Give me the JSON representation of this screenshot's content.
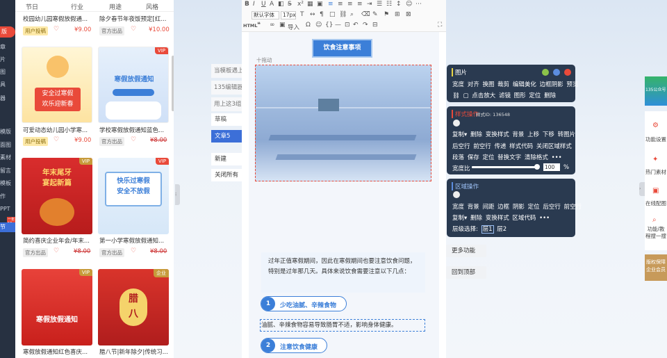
{
  "leftnav": {
    "items": [
      "版",
      "章",
      "片",
      "图",
      "具",
      "器",
      "模版",
      "面图",
      "素材",
      "留言",
      "模板",
      "作",
      "PPT",
      "节"
    ],
    "badge": "一年18"
  },
  "tplpanel": {
    "tabs": [
      "节日",
      "行业",
      "用途",
      "风格"
    ],
    "cards": [
      {
        "title": "校园幼儿园寒假放假通...",
        "tag": "用户投稿",
        "price": "¥9.00",
        "strike": false,
        "vip": false,
        "img_text": ""
      },
      {
        "title": "除夕春节年夜饭预定[红...",
        "tag": "官方出品",
        "price": "¥10.00",
        "strike": false,
        "vip": false,
        "img_text": ""
      },
      {
        "title": "可爱动态幼儿园小学寒...",
        "tag": "用户投稿",
        "price": "¥9.00",
        "strike": false,
        "vip": false,
        "img_text": "安全过寒假\n欢乐迎新春"
      },
      {
        "title": "学校寒假放假通知蓝色...",
        "tag": "官方出品",
        "price": "¥8.00",
        "strike": true,
        "vip": true,
        "img_text": "寒假放假通知"
      },
      {
        "title": "简约喜庆企业年会/年末...",
        "tag": "官方出品",
        "price": "¥8.00",
        "strike": true,
        "vip": true,
        "img_text": "年末尾牙\n宴起新篇"
      },
      {
        "title": "第一小学寒假放假通知...",
        "tag": "官方出品",
        "price": "¥8.00",
        "strike": true,
        "vip": true,
        "img_text": "快乐过寒假\n安全不放假"
      },
      {
        "title": "寒假放假通知红色喜庆...",
        "tag": "",
        "price": "",
        "strike": false,
        "vip": true,
        "img_text": "寒假放假通知"
      },
      {
        "title": "腊八节|新年除夕|传统习...",
        "tag": "",
        "price": "",
        "strike": false,
        "vip": false,
        "badge": "企业",
        "img_text": "腊\n八"
      }
    ]
  },
  "doclist": {
    "links": [
      "当模板遇上",
      "135编辑器",
      "用上这3组"
    ],
    "drafts": [
      "草稿",
      "文章5"
    ],
    "actions": [
      "新建",
      "关闭所有"
    ]
  },
  "toolbar": {
    "font_family": "默认字体",
    "font_size": "17px",
    "html_label": "HTML",
    "import_label": "导入"
  },
  "content": {
    "heading": "饮食注意事项",
    "drag_label": "十拖动",
    "intro": "过年正值寒假期间，因此在寒假期间也要注意饮食问题，特别是过年那几天。具体来说饮食需要注意以下几点：",
    "section1_num": "1",
    "section1_title": "少吃油腻、辛辣食物",
    "section1_text": "油腻、辛辣食物容易导致肠胃不适，影响身体健康。",
    "section2_num": "2",
    "section2_title": "注意饮食健康"
  },
  "panel_image": {
    "title": "图片",
    "row1": [
      "宽度",
      "对齐",
      "换图",
      "裁剪",
      "编辑美化",
      "边框阴影",
      "预览"
    ],
    "row2": [
      "点击放大",
      "滤镜",
      "图形",
      "定位",
      "删除"
    ]
  },
  "panel_style": {
    "title": "样式操作",
    "style_id": "样式ID: 136548",
    "row1": [
      "复制",
      "删除",
      "变换样式",
      "背景",
      "上移",
      "下移",
      "转图片"
    ],
    "row2": [
      "后空行",
      "前空行",
      "传递",
      "样式代码",
      "关闭区域样式"
    ],
    "row3": [
      "段落",
      "保存",
      "定位",
      "替换文字",
      "清除格式",
      "•••"
    ],
    "width_label": "宽度比",
    "width_value": "100",
    "width_unit": "%"
  },
  "panel_region": {
    "title": "区域操作",
    "row1": [
      "宽度",
      "背景",
      "间距",
      "边框",
      "阴影",
      "定位",
      "后空行",
      "前空行"
    ],
    "row2": [
      "复制",
      "删除",
      "变换样式",
      "区域代码",
      "•••"
    ],
    "layer_label": "层级选择:",
    "layers": [
      "层1",
      "层2"
    ]
  },
  "side_buttons": [
    "更多功能",
    "回到顶部"
  ],
  "rightbar": {
    "items": [
      "功能设置",
      "热门素材",
      "在线配图",
      "功能/教程搜一搜"
    ],
    "promo_top": "135公众号",
    "promo_bottom": "版权保障 企业会员"
  },
  "colors": {
    "accent": "#e94a3a",
    "panel": "#2a3a50",
    "heading_bg": "#3c7fd8",
    "nav": "#273141"
  }
}
